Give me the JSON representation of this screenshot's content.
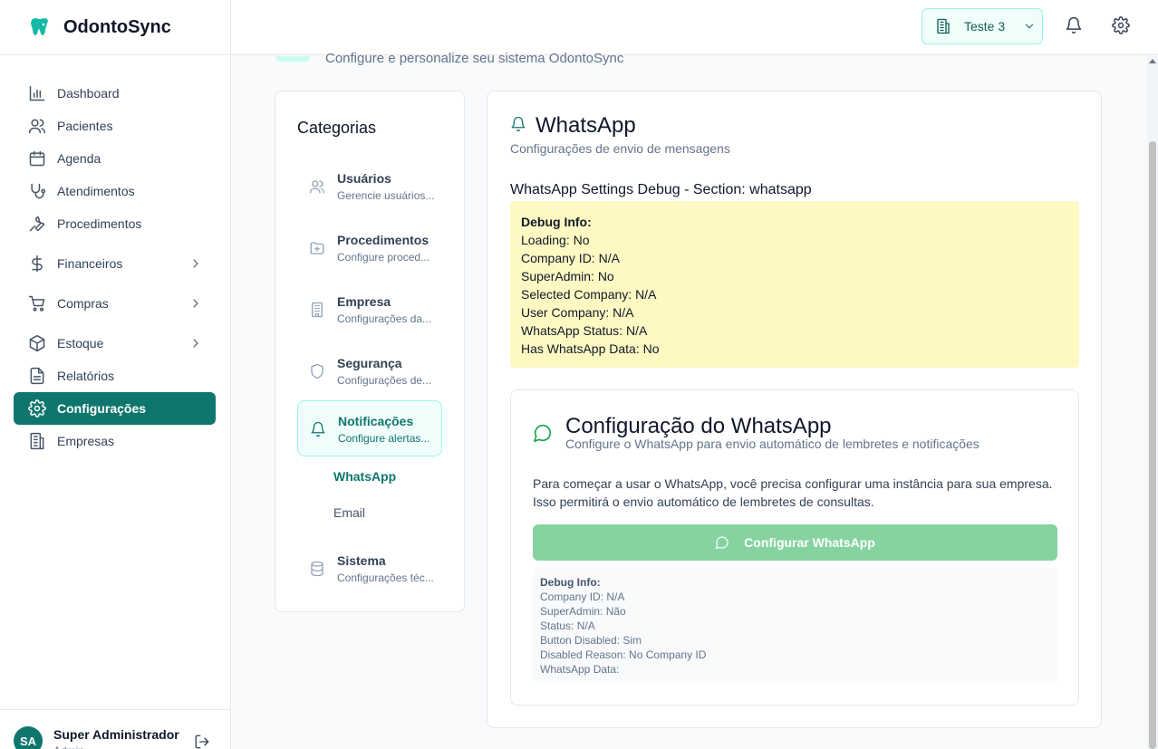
{
  "brand": {
    "name": "OdontoSync",
    "icon": "tooth-icon"
  },
  "sidebar": {
    "items": [
      {
        "label": "Dashboard",
        "icon": "chart-icon"
      },
      {
        "label": "Pacientes",
        "icon": "users-icon"
      },
      {
        "label": "Agenda",
        "icon": "calendar-icon"
      },
      {
        "label": "Atendimentos",
        "icon": "stethoscope-icon"
      },
      {
        "label": "Procedimentos",
        "icon": "wrench-icon"
      },
      {
        "label": "Financeiros",
        "icon": "dollar-icon",
        "expandable": true
      },
      {
        "label": "Compras",
        "icon": "cart-icon",
        "expandable": true
      },
      {
        "label": "Estoque",
        "icon": "package-icon",
        "expandable": true
      },
      {
        "label": "Relatórios",
        "icon": "file-icon"
      },
      {
        "label": "Configurações",
        "icon": "gear-icon",
        "active": true
      },
      {
        "label": "Empresas",
        "icon": "building-icon"
      }
    ]
  },
  "user": {
    "initials": "SA",
    "name": "Super Administrador",
    "role": "Admin"
  },
  "header": {
    "company": "Teste 3"
  },
  "page": {
    "subtitle": "Configure e personalize seu sistema OdontoSync"
  },
  "categories": {
    "title": "Categorias",
    "items": [
      {
        "label": "Usuários",
        "desc": "Gerencie usuários..."
      },
      {
        "label": "Procedimentos",
        "desc": "Configure proced..."
      },
      {
        "label": "Empresa",
        "desc": "Configurações da..."
      },
      {
        "label": "Segurança",
        "desc": "Configurações de..."
      },
      {
        "label": "Notificações",
        "desc": "Configure alertas...",
        "active": true
      },
      {
        "label": "Sistema",
        "desc": "Configurações téc..."
      }
    ],
    "subitems": [
      {
        "label": "WhatsApp",
        "active": true
      },
      {
        "label": "Email"
      }
    ]
  },
  "main": {
    "title": "WhatsApp",
    "subtitle": "Configurações de envio de mensagens",
    "debug_heading": "WhatsApp Settings Debug - Section: whatsapp",
    "debug_box": {
      "title": "Debug Info:",
      "lines": [
        "Loading: No",
        "Company ID: N/A",
        "SuperAdmin: No",
        "Selected Company: N/A",
        "User Company: N/A",
        "WhatsApp Status: N/A",
        "Has WhatsApp Data: No"
      ]
    },
    "wa_card": {
      "title": "Configuração do WhatsApp",
      "subtitle": "Configure o WhatsApp para envio automático de lembretes e notificações",
      "text_1": "Para começar a usar o WhatsApp, você precisa configurar uma instância para sua empresa.",
      "text_2": "Isso permitirá o envio automático de lembretes de consultas.",
      "button": "Configurar WhatsApp",
      "debug": {
        "title": "Debug Info:",
        "lines": [
          "Company ID: N/A",
          "SuperAdmin: Não",
          "Status: N/A",
          "Button Disabled: Sim",
          "Disabled Reason: No Company ID",
          "WhatsApp Data:"
        ]
      }
    }
  },
  "colors": {
    "accent": "#0f766e",
    "debug_bg": "#fef9c3",
    "button_disabled": "#86d3a0"
  }
}
